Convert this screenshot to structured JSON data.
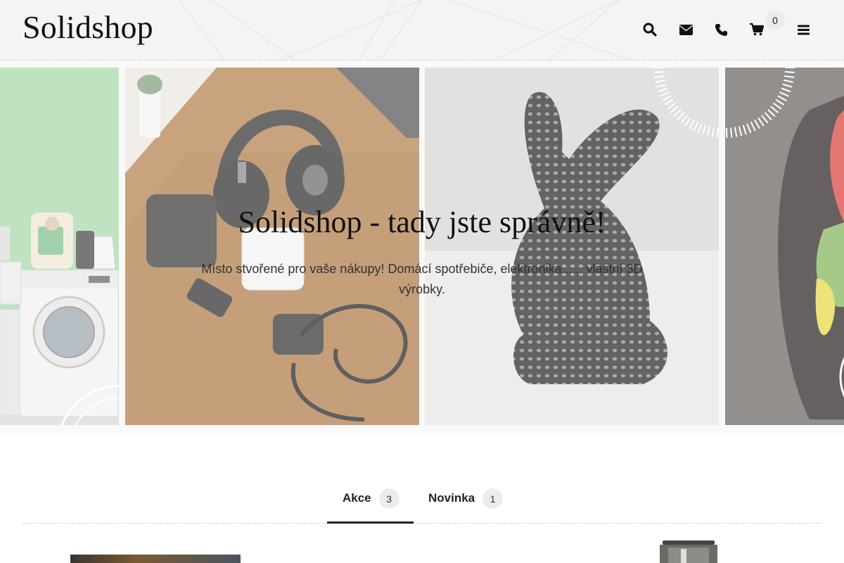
{
  "header": {
    "logo": "Solidshop",
    "icons": [
      "search-icon",
      "envelope-icon",
      "phone-icon",
      "cart-icon",
      "menu-icon"
    ],
    "cart_count": "0"
  },
  "hero": {
    "title": "Solidshop - tady jste správně!",
    "subtitle": "Místo stvořené pro vaše nákupy! Domácí spotřebiče, elektronika...... vlastní 3D výrobky."
  },
  "tabs": [
    {
      "label": "Akce",
      "count": "3",
      "active": true
    },
    {
      "label": "Novinka",
      "count": "1",
      "active": false
    }
  ],
  "colors": {
    "accent": "#222222",
    "badge_bg": "#ececec",
    "tile_green": "#a3d6a6",
    "tile_wood": "#b07a45",
    "tile_gray": "#c9c9c7"
  }
}
